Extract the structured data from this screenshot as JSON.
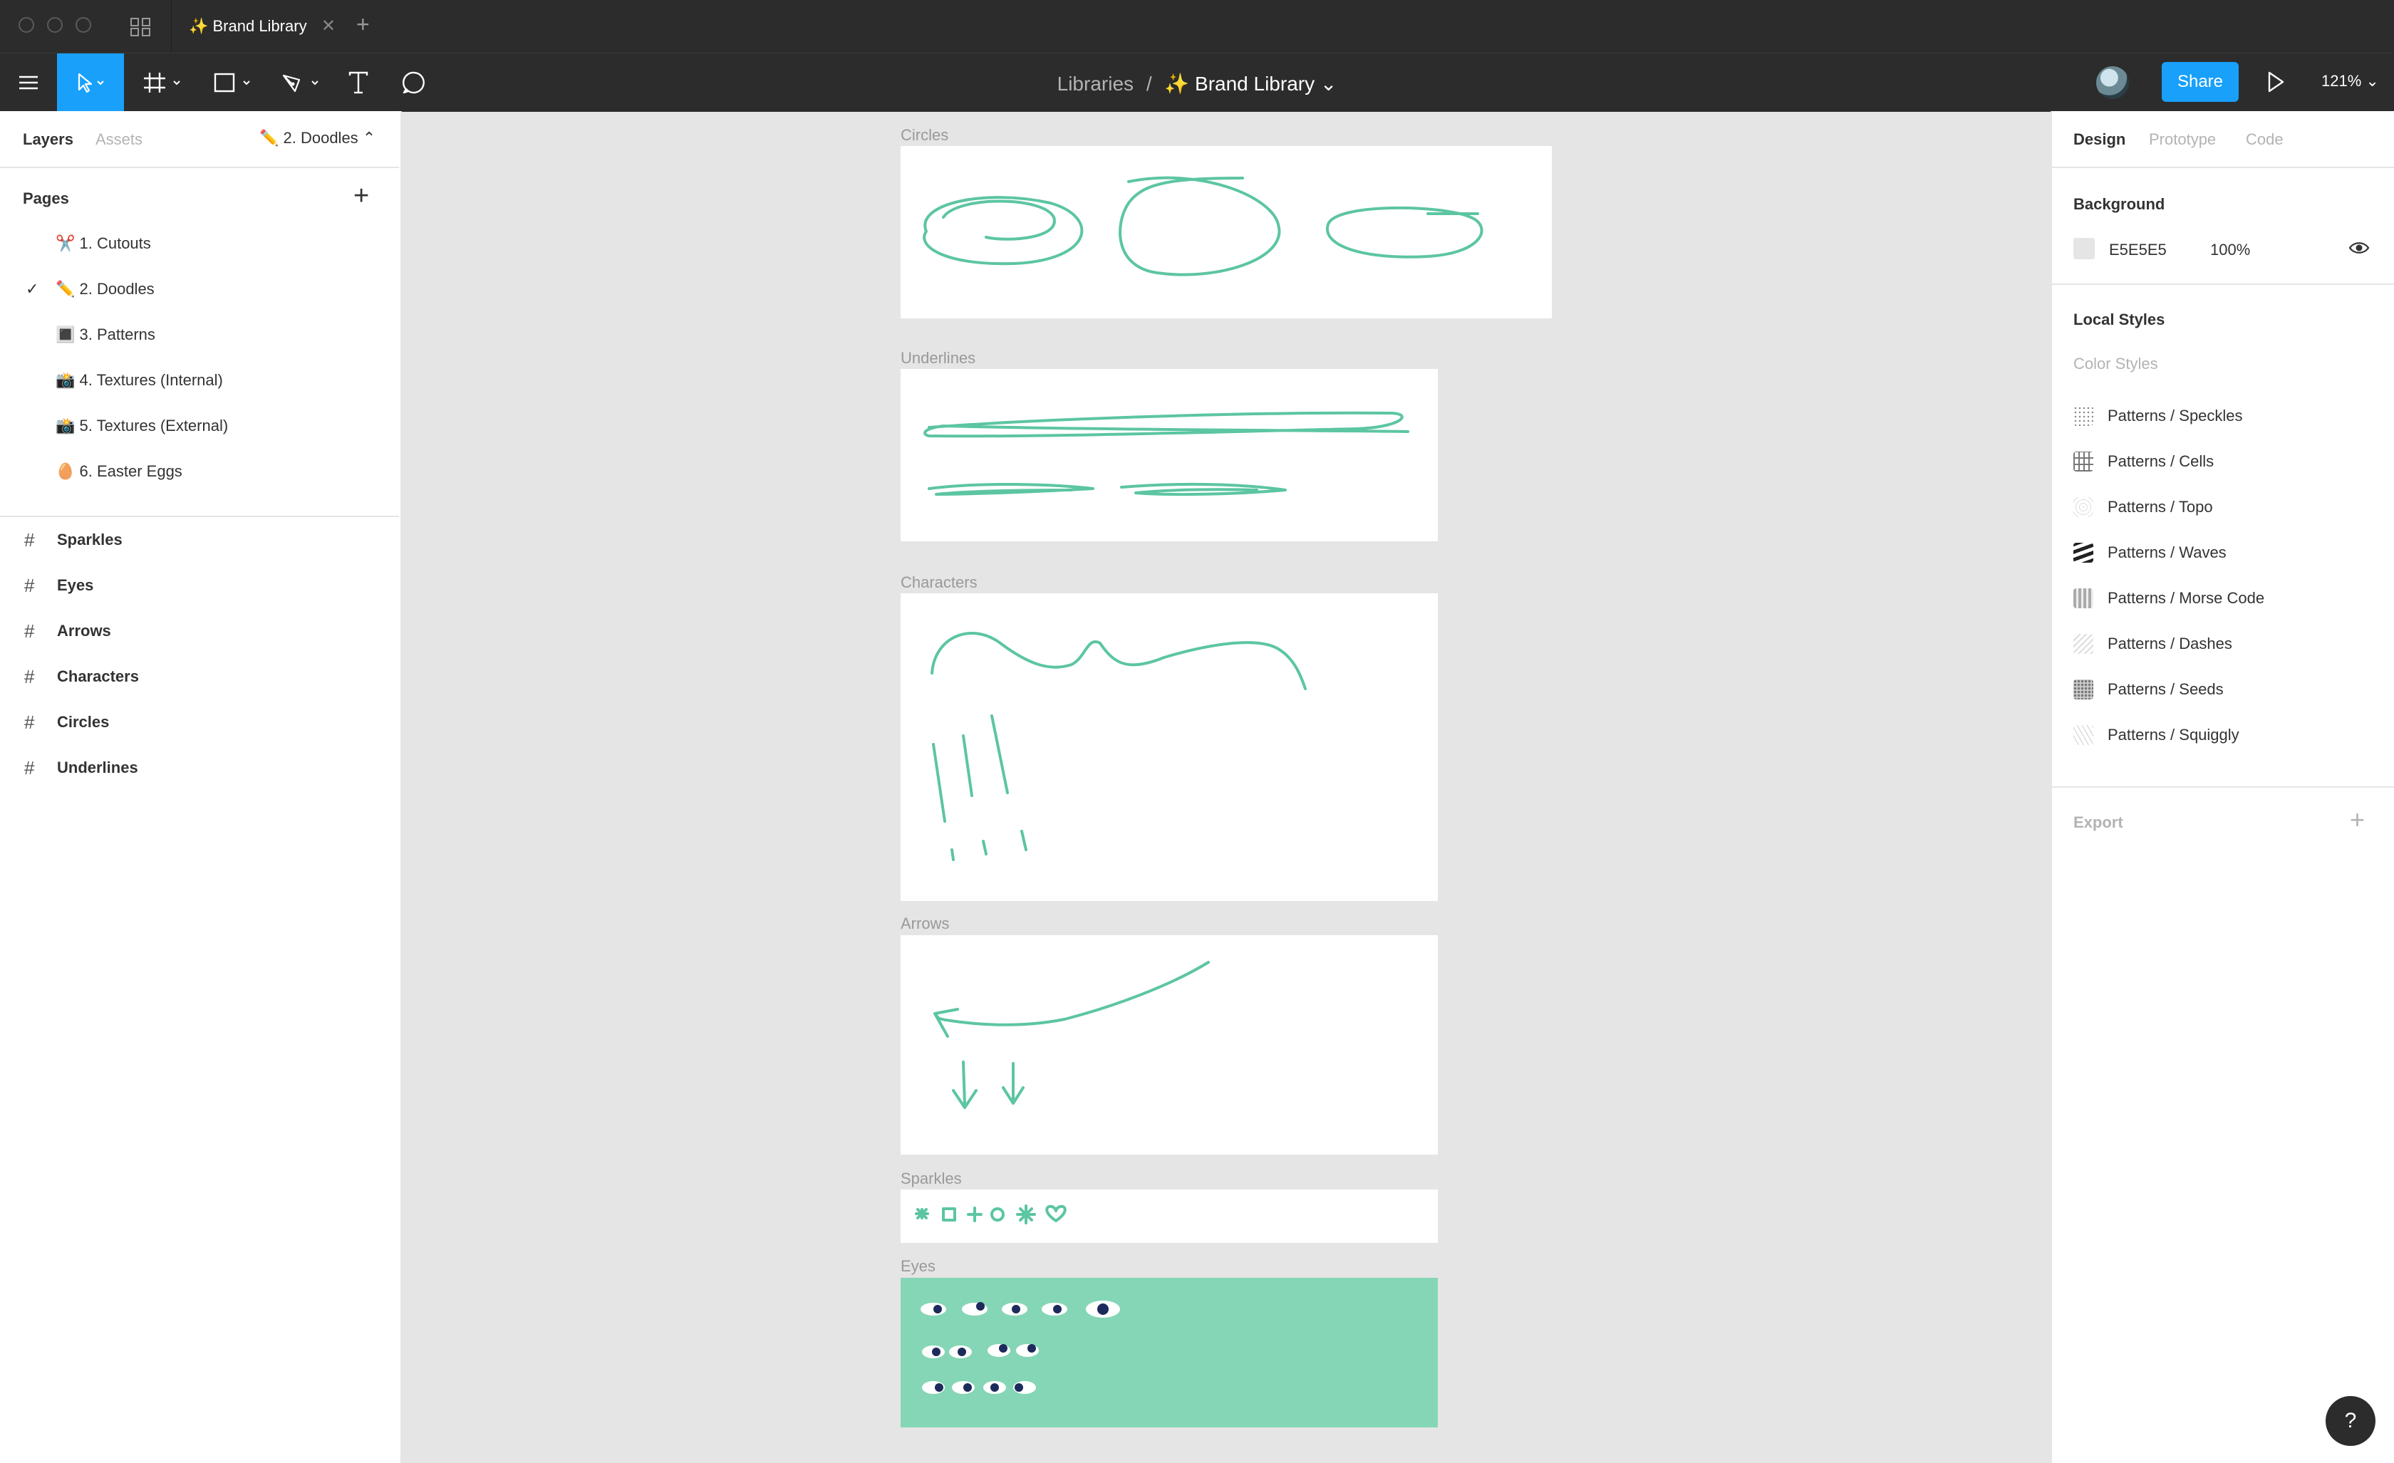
{
  "window": {
    "tab_title": "✨ Brand Library",
    "tab_close": "✕",
    "new_tab": "+"
  },
  "toolbar": {
    "breadcrumb_parent": "Libraries",
    "breadcrumb_sep": "/",
    "file_name": "✨ Brand Library ⌄",
    "share_label": "Share",
    "zoom": "121% ⌄"
  },
  "left_panel": {
    "tabs": {
      "layers": "Layers",
      "assets": "Assets"
    },
    "current_page": "✏️ 2. Doodles ⌃",
    "pages_heading": "Pages",
    "pages": [
      {
        "label": "✂️ 1. Cutouts",
        "selected": false
      },
      {
        "label": "✏️ 2. Doodles",
        "selected": true
      },
      {
        "label": "🔳 3. Patterns",
        "selected": false
      },
      {
        "label": "📸 4. Textures (Internal)",
        "selected": false
      },
      {
        "label": "📸 5. Textures (External)",
        "selected": false
      },
      {
        "label": "🥚 6. Easter Eggs",
        "selected": false
      }
    ],
    "check_mark": "✓",
    "layers": [
      "Sparkles",
      "Eyes",
      "Arrows",
      "Characters",
      "Circles",
      "Underlines"
    ],
    "layer_icon": "#"
  },
  "canvas": {
    "background": "#E5E5E5",
    "ink_color": "#5CC5A2",
    "frames": {
      "circles": "Circles",
      "underlines": "Underlines",
      "characters": "Characters",
      "arrows": "Arrows",
      "sparkles": "Sparkles",
      "eyes": "Eyes"
    }
  },
  "right_panel": {
    "tabs": {
      "design": "Design",
      "prototype": "Prototype",
      "code": "Code"
    },
    "background_heading": "Background",
    "background_hex": "E5E5E5",
    "background_opacity": "100%",
    "local_styles_heading": "Local Styles",
    "color_styles_label": "Color Styles",
    "styles": [
      "Patterns / Speckles",
      "Patterns / Cells",
      "Patterns / Topo",
      "Patterns / Waves",
      "Patterns / Morse Code",
      "Patterns / Dashes",
      "Patterns / Seeds",
      "Patterns / Squiggly"
    ],
    "export_label": "Export",
    "export_add": "+"
  },
  "help_label": "?"
}
